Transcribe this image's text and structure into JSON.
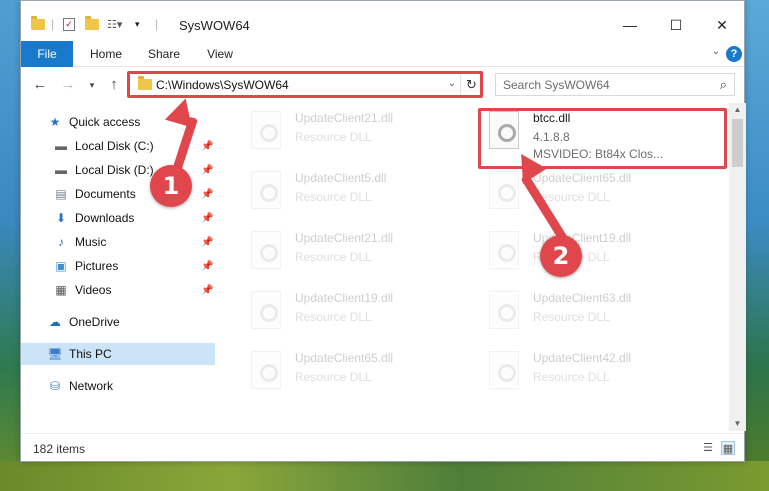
{
  "window": {
    "title": "SysWOW64",
    "minimize_label": "—",
    "maximize_label": "☐",
    "close_label": "✕"
  },
  "ribbon": {
    "tabs": [
      {
        "label": "File"
      },
      {
        "label": "Home"
      },
      {
        "label": "Share"
      },
      {
        "label": "View"
      }
    ],
    "help_label": "?"
  },
  "nav": {
    "address": "C:\\Windows\\SysWOW64",
    "search_placeholder": "Search SysWOW64"
  },
  "sidebar": {
    "items": [
      {
        "label": "Quick access",
        "icon": "star-icon"
      },
      {
        "label": "Local Disk (C:)",
        "icon": "drive-icon"
      },
      {
        "label": "Local Disk (D:)",
        "icon": "drive-icon"
      },
      {
        "label": "Documents",
        "icon": "documents-icon"
      },
      {
        "label": "Downloads",
        "icon": "download-icon"
      },
      {
        "label": "Music",
        "icon": "music-icon"
      },
      {
        "label": "Pictures",
        "icon": "pictures-icon"
      },
      {
        "label": "Videos",
        "icon": "videos-icon"
      },
      {
        "label": "OneDrive",
        "icon": "cloud-icon"
      },
      {
        "label": "This PC",
        "icon": "pc-icon"
      },
      {
        "label": "Network",
        "icon": "network-icon"
      }
    ]
  },
  "files": {
    "left": [
      {
        "name": "UpdateClient21.dll",
        "type": "Resource DLL"
      },
      {
        "name": "UpdateClient5.dll",
        "type": "Resource DLL"
      },
      {
        "name": "UpdateClient21.dll",
        "type": "Resource DLL"
      },
      {
        "name": "UpdateClient19.dll",
        "type": "Resource DLL"
      },
      {
        "name": "UpdateClient65.dll",
        "type": "Resource DLL"
      }
    ],
    "right": [
      {
        "name": "btcc.dll",
        "version": "4.1.8.8",
        "description": "MSVIDEO: Bt84x Clos..."
      },
      {
        "name": "UpdateClient65.dll",
        "type": "Resource DLL"
      },
      {
        "name": "UpdateClient19.dll",
        "type": "Resource DLL"
      },
      {
        "name": "UpdateClient63.dll",
        "type": "Resource DLL"
      },
      {
        "name": "UpdateClient42.dll",
        "type": "Resource DLL"
      }
    ]
  },
  "status": {
    "item_count": "182 items"
  },
  "annotations": {
    "step1": "1",
    "step2": "2"
  },
  "colors": {
    "accent": "#1979ca",
    "annotation_red": "#e0474c",
    "selected_bg": "#cce4f7"
  }
}
